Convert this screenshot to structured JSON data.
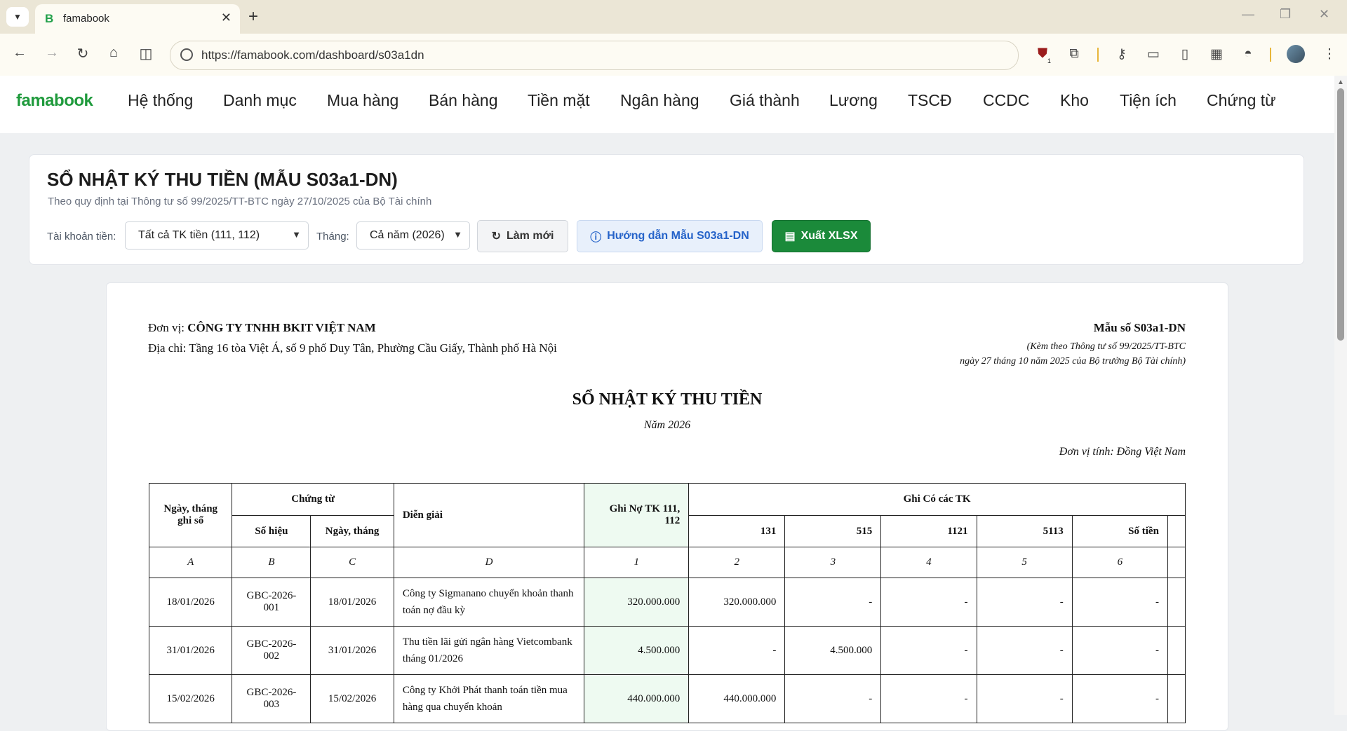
{
  "browser": {
    "tab_favicon": "B",
    "tab_title": "famabook",
    "url": "https://famabook.com/dashboard/s03a1dn",
    "extension_badge": "1"
  },
  "app": {
    "brand": "famabook",
    "menu": [
      "Hệ thống",
      "Danh mục",
      "Mua hàng",
      "Bán hàng",
      "Tiền mặt",
      "Ngân hàng",
      "Giá thành",
      "Lương",
      "TSCĐ",
      "CCDC",
      "Kho",
      "Tiện ích",
      "Chứng từ"
    ]
  },
  "header": {
    "title": "SỔ NHẬT KÝ THU TIỀN (MẪU S03a1-DN)",
    "subtitle": "Theo quy định tại Thông tư số 99/2025/TT-BTC ngày 27/10/2025 của Bộ Tài chính",
    "account_label": "Tài khoản tiền:",
    "account_value": "Tất cả TK tiền (111, 112)",
    "month_label": "Tháng:",
    "month_value": "Cả năm (2026)",
    "refresh_label": "Làm mới",
    "guide_label": "Hướng dẫn Mẫu S03a1-DN",
    "export_label": "Xuất XLSX"
  },
  "document": {
    "unit_label": "Đơn vị:",
    "unit_name": "CÔNG TY TNHH BKIT VIỆT NAM",
    "address_label": "Địa chỉ:",
    "address": "Tầng 16 tòa Việt Á, số 9 phố Duy Tân, Phường Cầu Giấy, Thành phố Hà Nội",
    "form_no": "Mẫu số S03a1-DN",
    "form_ref1": "(Kèm theo Thông tư số 99/2025/TT-BTC",
    "form_ref2": "ngày 27 tháng 10 năm 2025 của Bộ trưởng Bộ Tài chính)",
    "title": "SỔ NHẬT KÝ THU TIỀN",
    "year": "Năm 2026",
    "currency": "Đơn vị tính: Đồng Việt Nam"
  },
  "table": {
    "h_date": "Ngày, tháng ghi sổ",
    "h_voucher": "Chứng từ",
    "h_voucher_no": "Số hiệu",
    "h_voucher_date": "Ngày, tháng",
    "h_desc": "Diễn giải",
    "h_debit": "Ghi Nợ TK 111, 112",
    "h_credit": "Ghi Có các TK",
    "h_credit_cols": [
      "131",
      "515",
      "1121",
      "5113",
      "Số tiền"
    ],
    "codes": [
      "A",
      "B",
      "C",
      "D",
      "1",
      "2",
      "3",
      "4",
      "5",
      "6"
    ],
    "rows": [
      {
        "date": "18/01/2026",
        "no": "GBC-2026-001",
        "vdate": "18/01/2026",
        "desc": "Công ty Sigmanano chuyển khoản thanh toán nợ đầu kỳ",
        "debit": "320.000.000",
        "c131": "320.000.000",
        "c515": "-",
        "c1121": "-",
        "c5113": "-",
        "other": "-"
      },
      {
        "date": "31/01/2026",
        "no": "GBC-2026-002",
        "vdate": "31/01/2026",
        "desc": "Thu tiền lãi gửi ngân hàng Vietcombank tháng 01/2026",
        "debit": "4.500.000",
        "c131": "-",
        "c515": "4.500.000",
        "c1121": "-",
        "c5113": "-",
        "other": "-"
      },
      {
        "date": "15/02/2026",
        "no": "GBC-2026-003",
        "vdate": "15/02/2026",
        "desc": "Công ty Khởi Phát thanh toán tiền mua hàng qua chuyển khoản",
        "debit": "440.000.000",
        "c131": "440.000.000",
        "c515": "-",
        "c1121": "-",
        "c5113": "-",
        "other": "-"
      }
    ]
  }
}
